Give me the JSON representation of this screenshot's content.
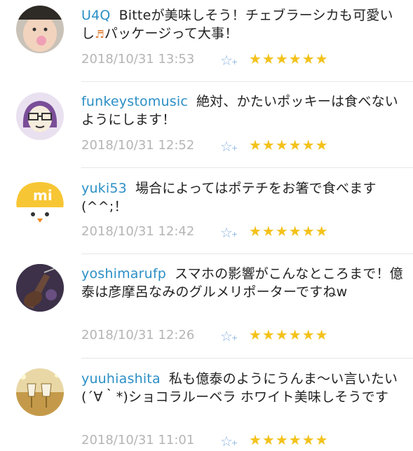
{
  "comments": [
    {
      "user": "U4Q",
      "text_a": "Bitteが美味しそう！チェブラーシカも可愛いし",
      "note_icon": "musical-note-icon",
      "note": "♬",
      "text_b": "パッケージって大事！",
      "time": "2018/10/31 13:53",
      "stars": "★★★★★★"
    },
    {
      "user": "funkeystomusic",
      "text": "絶対、かたいポッキーは食べないようにします！",
      "time": "2018/10/31 12:52",
      "stars": "★★★★★★"
    },
    {
      "user": "yuki53",
      "text": "場合によってはポテチをお箸で食べます(^^;！",
      "time": "2018/10/31 12:42",
      "stars": "★★★★★★"
    },
    {
      "user": "yoshimarufp",
      "text": "スマホの影響がこんなところまで！億泰は彦摩呂なみのグルメリポーターですねw",
      "time": "2018/10/31 12:26",
      "stars": "★★★★★★"
    },
    {
      "user": "yuuhiashita",
      "text": "私も億泰のようにうんま〜い言いたい(´∀｀*)ショコラルーベラ ホワイト美味しそうです",
      "time": "2018/10/31 11:01",
      "stars": "★★★★★★"
    }
  ],
  "add_star_icon": "add-star-icon",
  "add_star_glyph": "☆",
  "add_star_plus": "+",
  "colors": {
    "username": "#2b8fc6",
    "star": "#f3c21b",
    "timestamp": "#b5b5b5"
  }
}
